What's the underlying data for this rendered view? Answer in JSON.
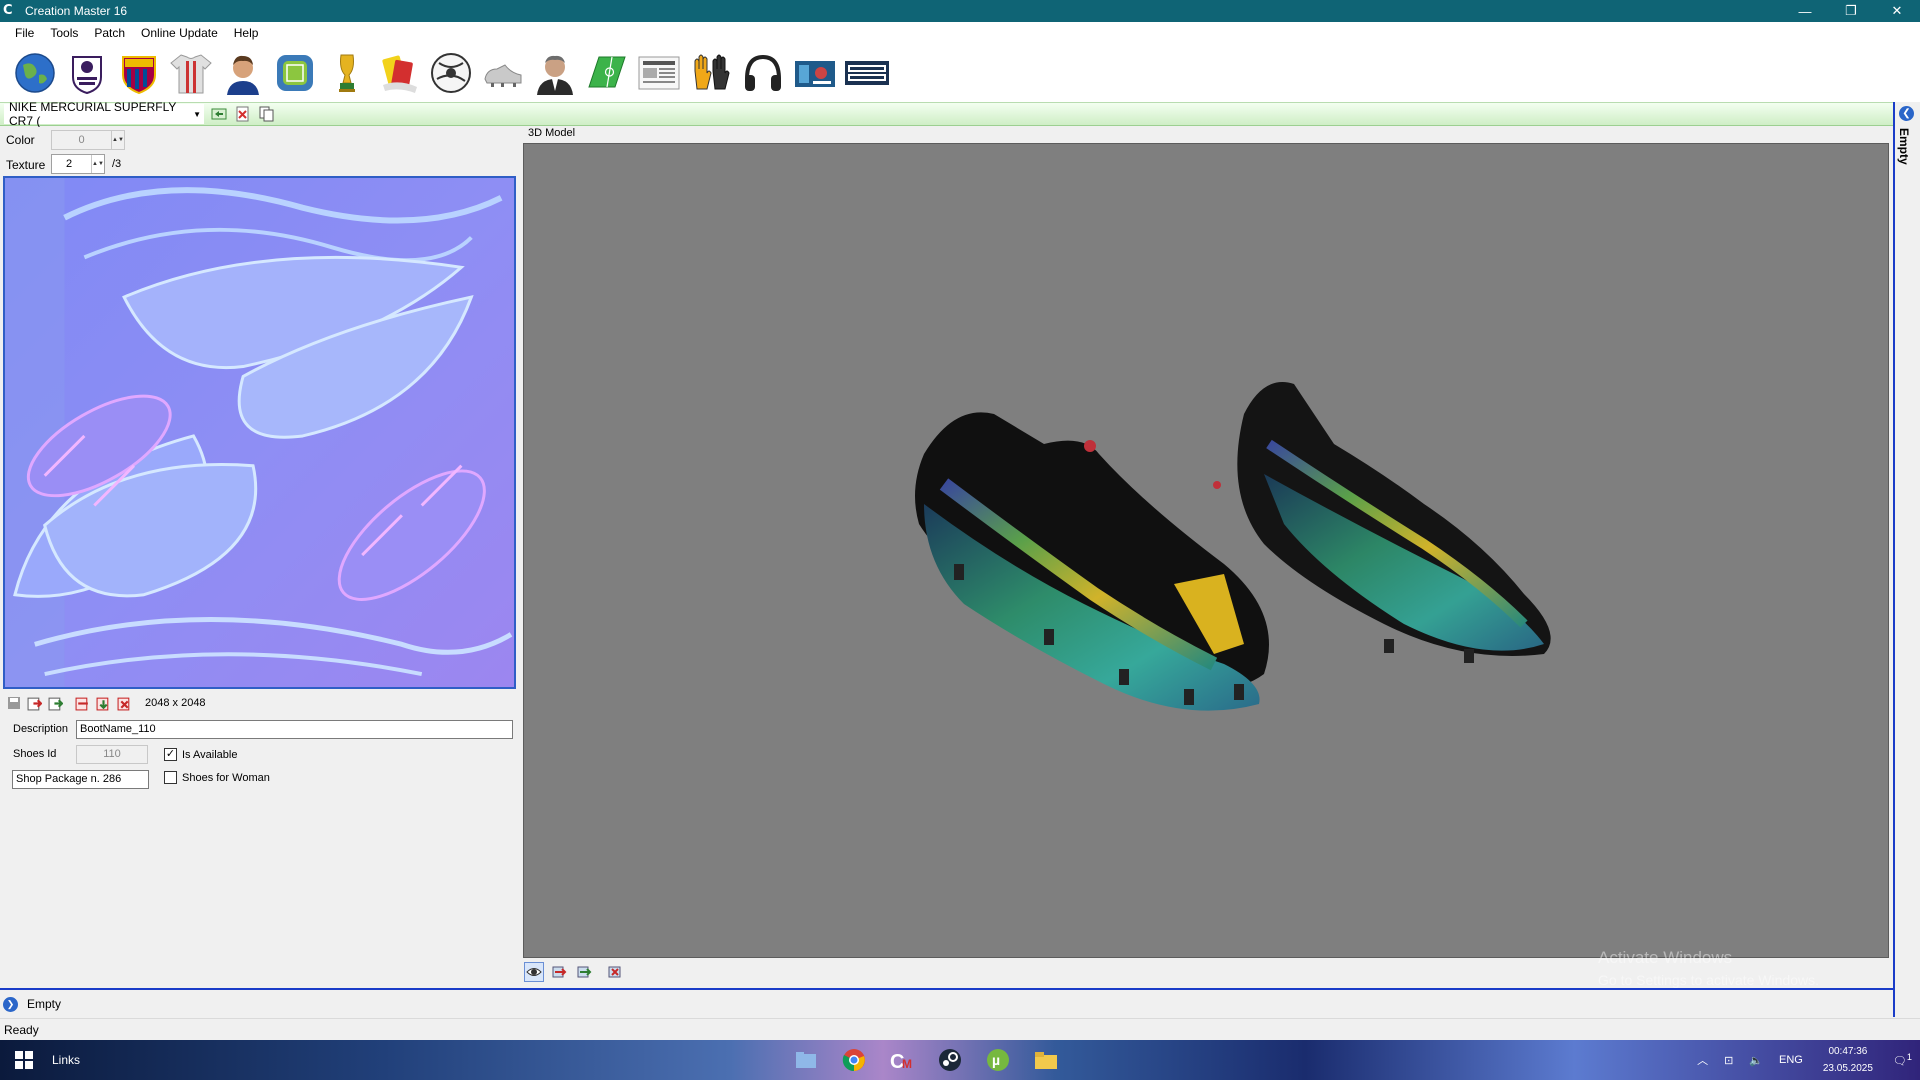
{
  "window": {
    "title": "Creation Master 16",
    "app_icon_text": "C",
    "minimize": "—",
    "restore": "❐",
    "close": "✕"
  },
  "menu": [
    "File",
    "Tools",
    "Patch",
    "Online Update",
    "Help"
  ],
  "toolbar_icons": [
    "globe-icon",
    "premier-league-icon",
    "club-crest-icon",
    "kit-icon",
    "player-icon",
    "stadium-icon",
    "trophy-icon",
    "referee-card-icon",
    "ball-icon",
    "boots-icon",
    "manager-icon",
    "pitch-icon",
    "newspaper-icon",
    "gloves-icon",
    "headphones-icon",
    "tv-icon",
    "transfermarkt-icon"
  ],
  "item_bar": {
    "selected_item": "NIKE MERCURIAL SUPERFLY CR7 (",
    "arrow": "▼"
  },
  "left_panel": {
    "color_label": "Color",
    "color_value": "0",
    "texture_label": "Texture",
    "texture_value": "2",
    "texture_total": "/3",
    "texture_size": "2048 x 2048",
    "description_label": "Description",
    "description_value": "BootName_110",
    "shoes_id_label": "Shoes Id",
    "shoes_id_value": "110",
    "is_available_label": "Is Available",
    "is_available_checked": true,
    "shoes_for_woman_label": "Shoes for Woman",
    "shoes_for_woman_checked": false,
    "shop_package": "Shop Package n. 286"
  },
  "viewer": {
    "label": "3D Model",
    "watermark_title": "Activate Windows",
    "watermark_sub": "Go to Settings to activate Windows."
  },
  "side_panel": {
    "label": "Empty"
  },
  "bottom_panel": {
    "label": "Empty"
  },
  "status": {
    "text": "Ready"
  },
  "taskbar": {
    "links_label": "Links",
    "language": "ENG",
    "time": "00:47:36",
    "date": "23.05.2025",
    "notifications": "1"
  }
}
